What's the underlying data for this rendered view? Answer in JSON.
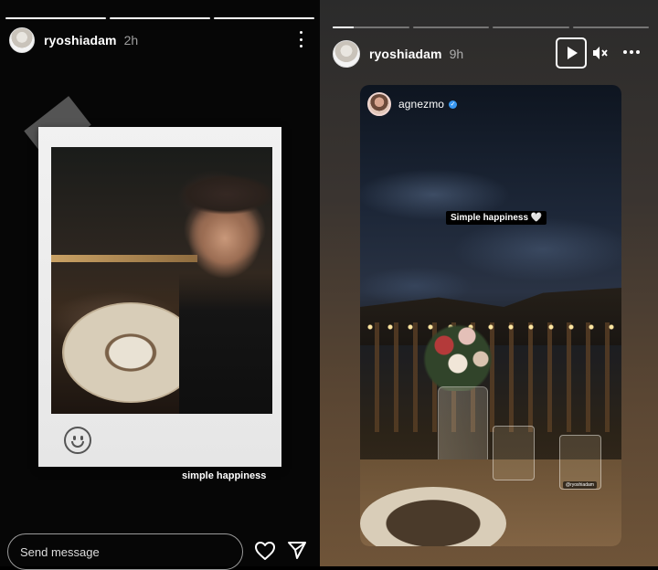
{
  "left_story": {
    "progress": [
      1,
      1,
      1
    ],
    "user": {
      "name": "ryoshiadam",
      "time": "2h"
    },
    "caption": "simple happiness",
    "reply": {
      "placeholder": "Send message"
    },
    "icons": {
      "more": "more-vertical-icon",
      "like": "heart-icon",
      "send": "send-icon",
      "sticker": "smiley-icon"
    }
  },
  "right_story": {
    "progress": [
      0.28,
      0,
      0,
      0
    ],
    "user": {
      "name": "ryoshiadam",
      "time": "9h"
    },
    "controls": {
      "play": "play-icon",
      "mute": "mute-icon",
      "more": "more-horizontal-icon"
    },
    "embedded_post": {
      "user": "agnezmo",
      "verified": true,
      "sticker_text": "Simple happiness 🤍",
      "tag": "@ryoshiadam"
    }
  },
  "colors": {
    "verified_badge": "#3897f0",
    "background": "#000000"
  }
}
